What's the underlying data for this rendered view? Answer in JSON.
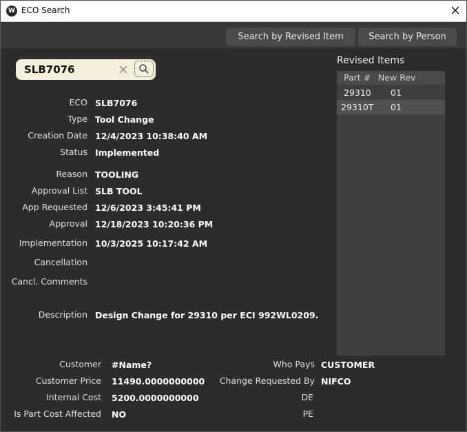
{
  "window": {
    "title": "ECO Search",
    "app_icon_text": "W"
  },
  "toolbar": {
    "search_by_revised_item": "Search by Revised Item",
    "search_by_person": "Search by Person"
  },
  "search": {
    "value": "SLB7076"
  },
  "details": [
    {
      "label": "ECO",
      "value": "SLB7076"
    },
    {
      "label": "Type",
      "value": "Tool Change"
    },
    {
      "label": "Creation Date",
      "value": "12/4/2023 10:38:40 AM"
    },
    {
      "label": "Status",
      "value": "Implemented"
    },
    {
      "label": "Reason",
      "value": "TOOLING"
    },
    {
      "label": "Approval List",
      "value": "SLB TOOL"
    },
    {
      "label": "App Requested",
      "value": "12/6/2023 3:45:41 PM"
    },
    {
      "label": "Approval",
      "value": "12/18/2023 10:20:36 PM"
    },
    {
      "label": "Implementation",
      "value": "10/3/2025 10:17:42 AM"
    },
    {
      "label": "Cancellation",
      "value": ""
    },
    {
      "label": "Cancl. Comments",
      "value": ""
    },
    {
      "label": "Description",
      "value": "Design Change for 29310 per ECI 992WL0209."
    }
  ],
  "revised_items": {
    "title": "Revised Items",
    "columns": [
      "Part #",
      "New Rev"
    ],
    "rows": [
      {
        "part": "29310",
        "rev": "01"
      },
      {
        "part": "29310T",
        "rev": "01"
      }
    ]
  },
  "cost_left": [
    {
      "label": "Customer",
      "value": "#Name?"
    },
    {
      "label": "Customer Price",
      "value": "11490.0000000000"
    },
    {
      "label": "Internal Cost",
      "value": "5200.0000000000"
    },
    {
      "label": "Is Part Cost Affected",
      "value": "NO"
    }
  ],
  "cost_right": [
    {
      "label": "Who Pays",
      "value": "CUSTOMER"
    },
    {
      "label": "Change Requested By",
      "value": "NIFCO"
    },
    {
      "label": "DE",
      "value": ""
    },
    {
      "label": "PE",
      "value": ""
    }
  ],
  "colors": {
    "background": "#2c2c2c",
    "toolbar": "#383838",
    "button": "#4a4a4a",
    "search_bg": "#f5f0dc",
    "list_bg": "#3f3f3f",
    "selected_row": "#505050"
  }
}
